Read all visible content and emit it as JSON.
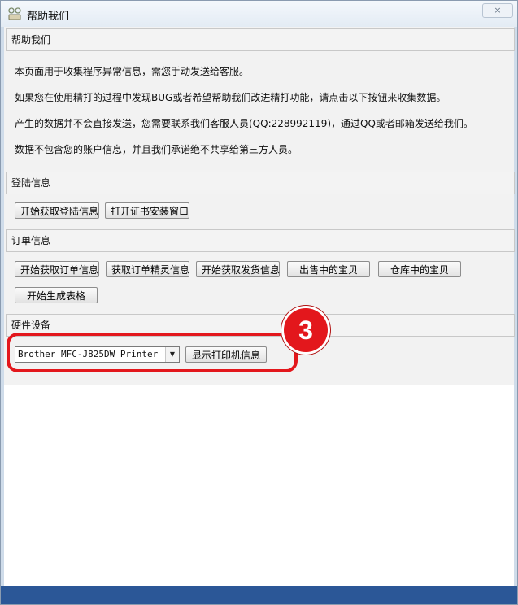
{
  "window": {
    "title": "帮助我们",
    "close_label": "×"
  },
  "help_section": {
    "header": "帮助我们",
    "lines": [
      "本页面用于收集程序异常信息，需您手动发送给客服。",
      "如果您在使用精打的过程中发现BUG或者希望帮助我们改进精打功能，请点击以下按钮来收集数据。",
      "产生的数据并不会直接发送，您需要联系我们客服人员(QQ:228992119)，通过QQ或者邮箱发送给我们。",
      "数据不包含您的账户信息，并且我们承诺绝不共享给第三方人员。"
    ]
  },
  "login_section": {
    "header": "登陆信息",
    "buttons": [
      "开始获取登陆信息",
      "打开证书安装窗口"
    ]
  },
  "order_section": {
    "header": "订单信息",
    "buttons": [
      "开始获取订单信息",
      "获取订单精灵信息",
      "开始获取发货信息",
      "出售中的宝贝",
      "仓库中的宝贝",
      "开始生成表格"
    ]
  },
  "hardware_section": {
    "header": "硬件设备",
    "printer_select_value": "Brother MFC-J825DW Printer",
    "show_printer_button": "显示打印机信息"
  },
  "annotation": {
    "step_number": "3",
    "color": "#e3171c"
  },
  "colors": {
    "footer_bar": "#2b5797"
  }
}
